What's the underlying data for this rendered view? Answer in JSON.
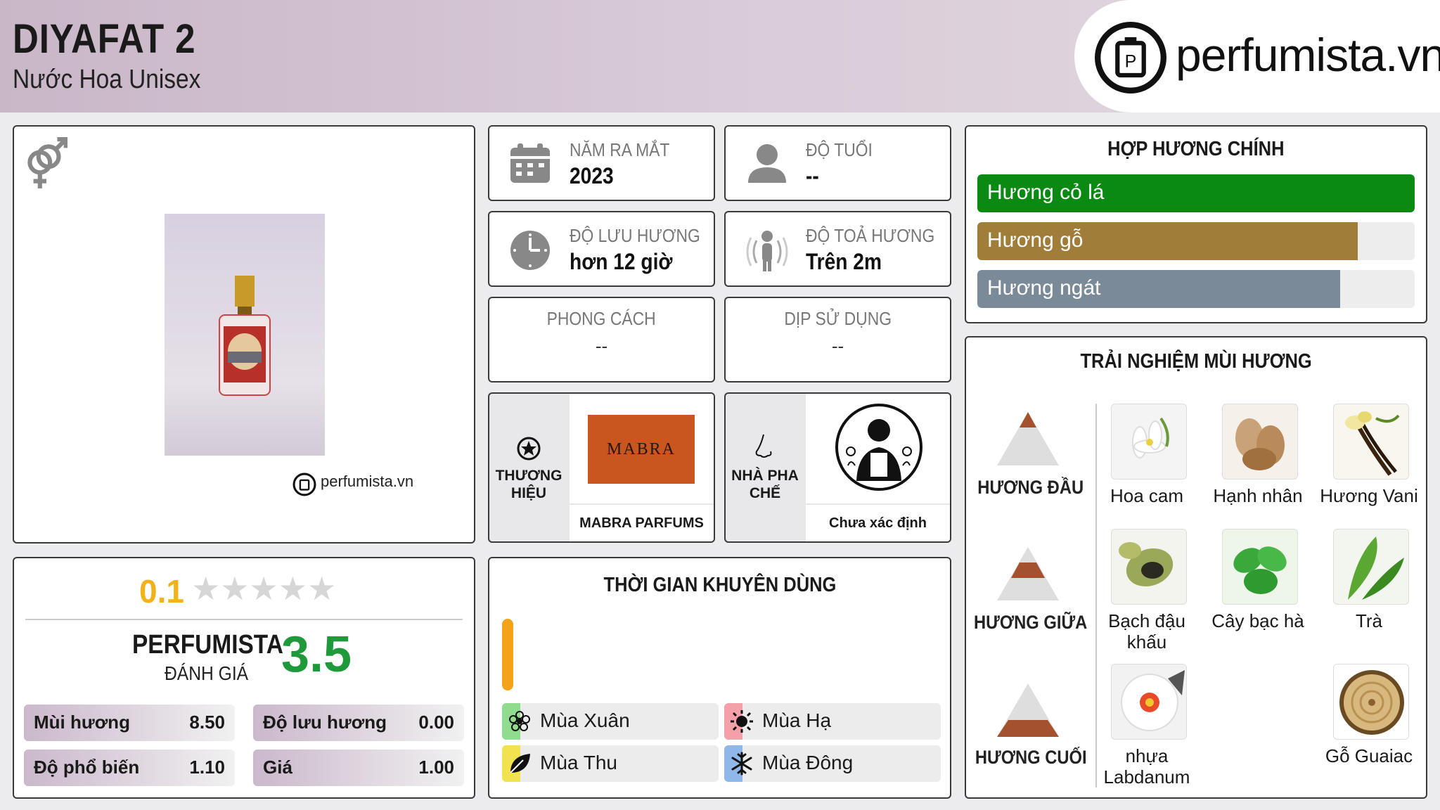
{
  "header": {
    "title": "DIYAFAT 2",
    "subtitle": "Nước Hoa Unisex",
    "logo_text": "perfumista.vn"
  },
  "product": {
    "watermark": "perfumista.vn",
    "gender_icon": "unisex-icon"
  },
  "info": {
    "release": {
      "label": "NĂM RA MẮT",
      "value": "2023"
    },
    "age": {
      "label": "ĐỘ TUỔI",
      "value": "--"
    },
    "longevity": {
      "label": "ĐỘ LƯU HƯƠNG",
      "value": "hơn 12 giờ"
    },
    "sillage": {
      "label": "ĐỘ TOẢ HƯƠNG",
      "value": "Trên 2m"
    },
    "style": {
      "label": "PHONG CÁCH",
      "value": "--"
    },
    "occasion": {
      "label": "DỊP SỬ DỤNG",
      "value": "--"
    },
    "brand": {
      "label": "THƯƠNG HIỆU",
      "logo": "MABRA",
      "name": "MABRA PARFUMS"
    },
    "perfumer": {
      "label": "NHÀ PHA CHẾ",
      "name": "Chưa xác định"
    }
  },
  "accords": {
    "title": "HỢP HƯƠNG CHÍNH",
    "items": [
      {
        "name": "Hương cỏ lá",
        "level": 1.0,
        "color": "#0a8a12"
      },
      {
        "name": "Hương gỗ",
        "level": 0.87,
        "color": "#a07e3a"
      },
      {
        "name": "Hương ngát",
        "level": 0.83,
        "color": "#7a8a99"
      }
    ]
  },
  "rating": {
    "user_score": "0.1",
    "stars": 5,
    "brand_label": "PERFUMISTA",
    "sub_label": "ĐÁNH GIÁ",
    "main_score": "3.5",
    "metrics": [
      {
        "label": "Mùi hương",
        "value": "8.50"
      },
      {
        "label": "Độ lưu hương",
        "value": "0.00"
      },
      {
        "label": "Độ phổ biến",
        "value": "1.10"
      },
      {
        "label": "Giá",
        "value": "1.00"
      }
    ]
  },
  "time": {
    "title": "THỜI GIAN KHUYÊN DÙNG",
    "day_color": "#f4a21a",
    "seasons": [
      {
        "name": "Mùa Xuân",
        "color": "#8fdc8f",
        "icon": "spring-flower-icon"
      },
      {
        "name": "Mùa Hạ",
        "color": "#f4a0a8",
        "icon": "sun-icon"
      },
      {
        "name": "Mùa Thu",
        "color": "#f2e250",
        "icon": "leaf-icon"
      },
      {
        "name": "Mùa Đông",
        "color": "#8fb8e8",
        "icon": "snowflake-icon"
      }
    ]
  },
  "notes": {
    "title": "TRẢI NGHIỆM MÙI HƯƠNG",
    "top": {
      "label": "HƯƠNG ĐẦU",
      "items": [
        "Hoa cam",
        "Hạnh nhân",
        "Hương Vani"
      ]
    },
    "middle": {
      "label": "HƯƠNG GIỮA",
      "items": [
        "Bạch đậu khấu",
        "Cây bạc hà",
        "Trà"
      ]
    },
    "base": {
      "label": "HƯƠNG CUỐI",
      "items": [
        "nhựa Labdanum",
        "Gỗ Guaiac"
      ]
    }
  }
}
